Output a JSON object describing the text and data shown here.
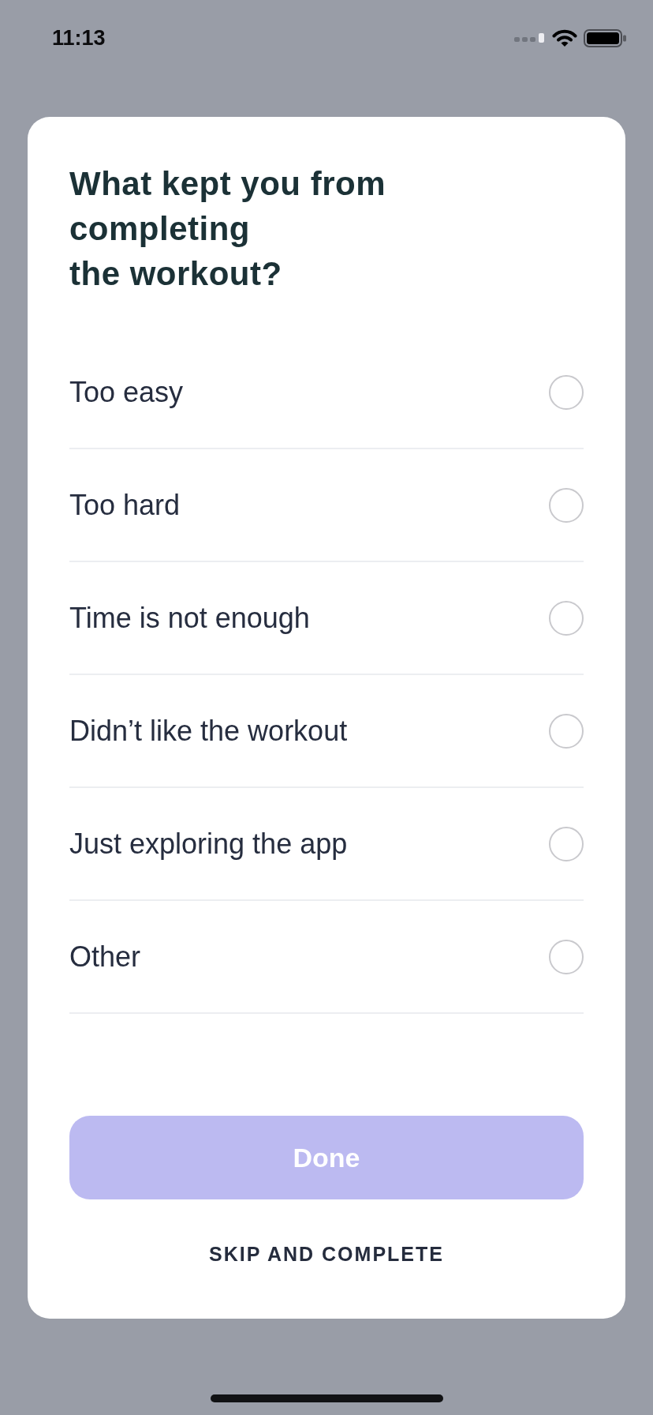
{
  "status_bar": {
    "time": "11:13"
  },
  "dialog": {
    "title": "What kept you from completing\nthe workout?",
    "options": [
      {
        "label": "Too easy",
        "selected": false
      },
      {
        "label": "Too hard",
        "selected": false
      },
      {
        "label": "Time is not enough",
        "selected": false
      },
      {
        "label": "Didn’t like the workout",
        "selected": false
      },
      {
        "label": "Just exploring the app",
        "selected": false
      },
      {
        "label": "Other",
        "selected": false
      }
    ],
    "done_button": {
      "label": "Done",
      "disabled": true
    },
    "skip_button": {
      "label": "SKIP AND COMPLETE"
    }
  }
}
